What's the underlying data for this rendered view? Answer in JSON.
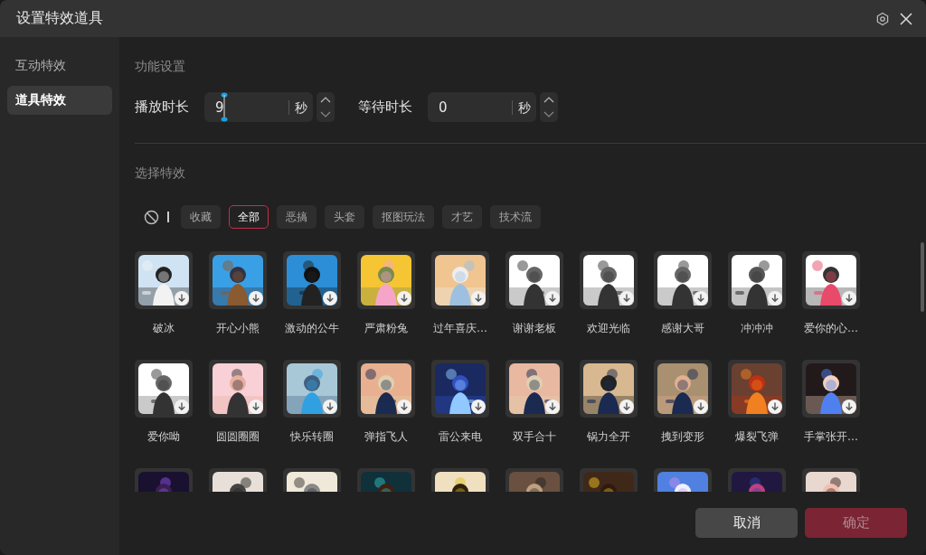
{
  "window": {
    "title": "设置特效道具"
  },
  "sidebar": {
    "items": [
      {
        "label": "互动特效",
        "selected": false
      },
      {
        "label": "道具特效",
        "selected": true
      }
    ]
  },
  "settings": {
    "heading": "功能设置",
    "fields": [
      {
        "label": "播放时长",
        "value": "9",
        "unit": "秒",
        "focused": true
      },
      {
        "label": "等待时长",
        "value": "0",
        "unit": "秒",
        "focused": false
      }
    ]
  },
  "effects": {
    "heading": "选择特效",
    "filters": [
      {
        "label": "收藏",
        "selected": false
      },
      {
        "label": "全部",
        "selected": true
      },
      {
        "label": "恶搞",
        "selected": false
      },
      {
        "label": "头套",
        "selected": false
      },
      {
        "label": "抠图玩法",
        "selected": false
      },
      {
        "label": "才艺",
        "selected": false
      },
      {
        "label": "技术流",
        "selected": false
      }
    ],
    "items": [
      {
        "label": "破冰",
        "kind": "picture"
      },
      {
        "label": "开心小熊",
        "kind": "picture"
      },
      {
        "label": "激动的公牛",
        "kind": "picture"
      },
      {
        "label": "严肃粉兔",
        "kind": "picture"
      },
      {
        "label": "过年喜庆…",
        "kind": "picture"
      },
      {
        "label": "谢谢老板",
        "kind": "picture"
      },
      {
        "label": "欢迎光临",
        "kind": "picture"
      },
      {
        "label": "感谢大哥",
        "kind": "picture"
      },
      {
        "label": "冲冲冲",
        "kind": "picture"
      },
      {
        "label": "爱你的心…",
        "kind": "picture"
      },
      {
        "label": "爱你呦",
        "kind": "picture"
      },
      {
        "label": "圆圆圈圈",
        "kind": "picture"
      },
      {
        "label": "快乐转圈",
        "kind": "picture"
      },
      {
        "label": "弹指飞人",
        "kind": "picture"
      },
      {
        "label": "雷公来电",
        "kind": "picture"
      },
      {
        "label": "双手合十",
        "kind": "picture"
      },
      {
        "label": "锅力全开",
        "kind": "picture"
      },
      {
        "label": "拽到变形",
        "kind": "picture"
      },
      {
        "label": "爆裂飞弹",
        "kind": "picture"
      },
      {
        "label": "手掌张开…",
        "kind": "picture"
      },
      {
        "kind": "picture"
      },
      {
        "kind": "picture"
      },
      {
        "kind": "picture"
      },
      {
        "kind": "picture"
      },
      {
        "kind": "picture"
      },
      {
        "kind": "picture"
      },
      {
        "kind": "picture"
      },
      {
        "kind": "picture"
      },
      {
        "kind": "picture"
      },
      {
        "kind": "picture"
      }
    ]
  },
  "buttons": [
    {
      "label": "取消",
      "kind": "cancel",
      "disabled": false
    },
    {
      "label": "确定",
      "kind": "confirm",
      "disabled": true
    }
  ]
}
